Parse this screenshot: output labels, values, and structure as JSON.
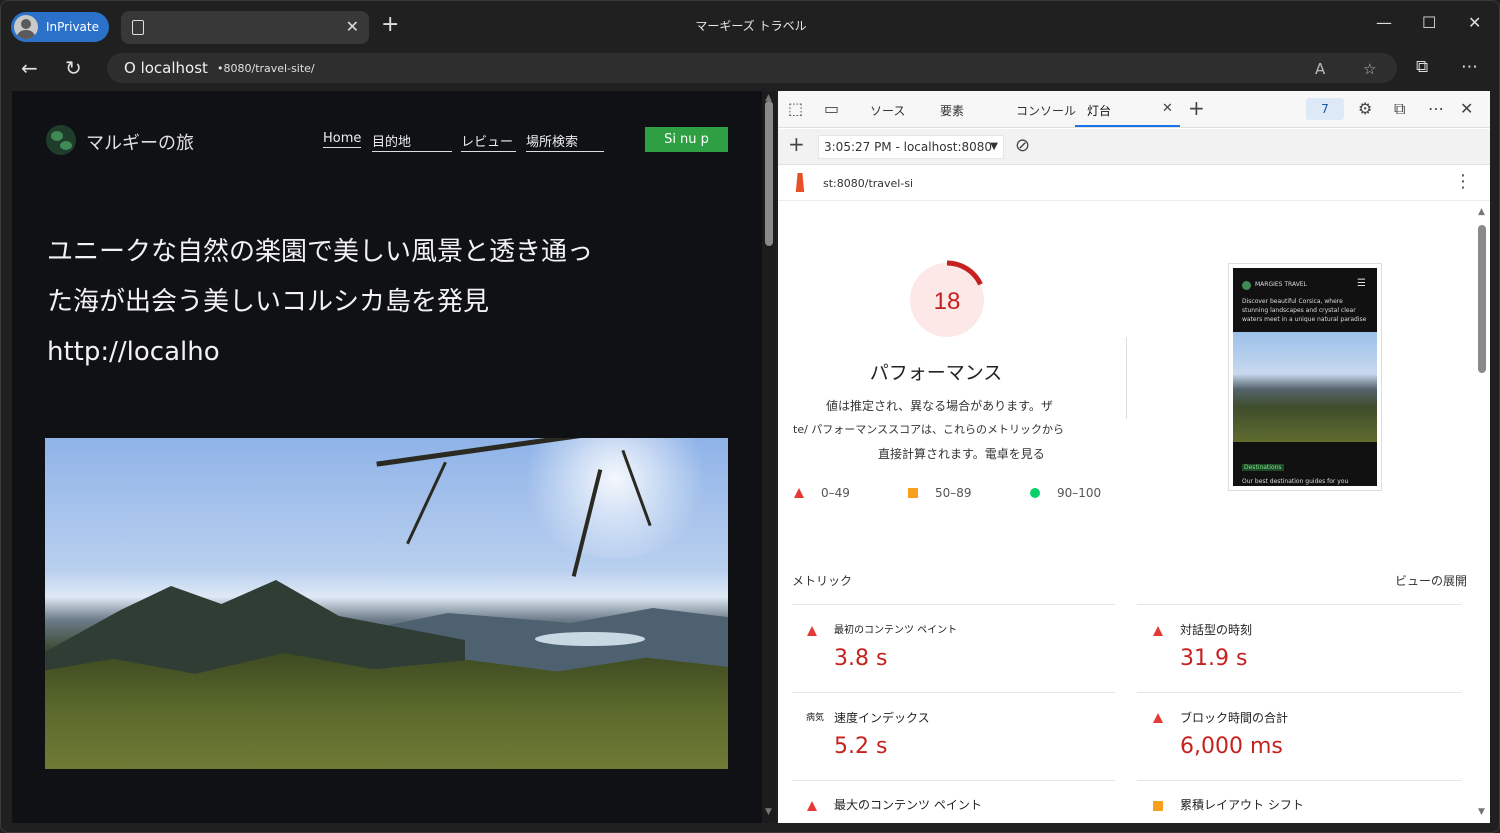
{
  "browser": {
    "inprivate_label": "InPrivate",
    "window_title": "マーギーズ トラベル",
    "address_host": "O localhost",
    "address_path": "•8080/travel-site/"
  },
  "site": {
    "brand": "マルギーの旅",
    "nav": [
      "Home",
      "目的地",
      "レビュー",
      "場所検索"
    ],
    "signup": "Si nu p",
    "hero": "ユニークな自然の楽園で美しい風景と透き通った海が出会う美しいコルシカ島を発見 http://localho"
  },
  "devtools": {
    "tabs": [
      "ソース",
      "要素",
      "コンソール",
      "灯台"
    ],
    "issues_count": "7",
    "report_label": "3:05:27 PM - localhost:8080",
    "url": "st:8080/travel-si",
    "score": 18,
    "score_color": "#c5221f",
    "perf_title": "パフォーマンス",
    "perf_desc": [
      "値は推定され、異なる場合があります。ザ",
      "te/ パフォーマンススコアは、これらのメトリックから",
      "直接計算されます。電卓を見る"
    ],
    "legend": [
      "0–49",
      "50–89",
      "90–100"
    ],
    "thumb": {
      "brand": "MARGIES TRAVEL",
      "text": "Discover beautiful Corsica, where stunning landscapes and crystal clear waters meet in a unique natural paradise",
      "tag": "Destinations",
      "foot": "Our best destination guides for you"
    },
    "metrics_label": "メトリック",
    "expand_label": "ビューの展開",
    "metrics": [
      {
        "title": "最初のコンテンツ ペイント",
        "value": "3.8 s",
        "status": "fail"
      },
      {
        "title": "対話型の時刻",
        "value": "31.9 s",
        "status": "fail"
      },
      {
        "title": "速度インデックス",
        "value": "5.2 s",
        "status": "fail",
        "prefix": "病気"
      },
      {
        "title": "ブロック時間の合計",
        "value": "6,000 ms",
        "status": "fail"
      },
      {
        "title": "最大のコンテンツ ペイント",
        "value": "",
        "status": "fail"
      },
      {
        "title": "累積レイアウト シフト",
        "value": "",
        "status": "average"
      }
    ]
  }
}
